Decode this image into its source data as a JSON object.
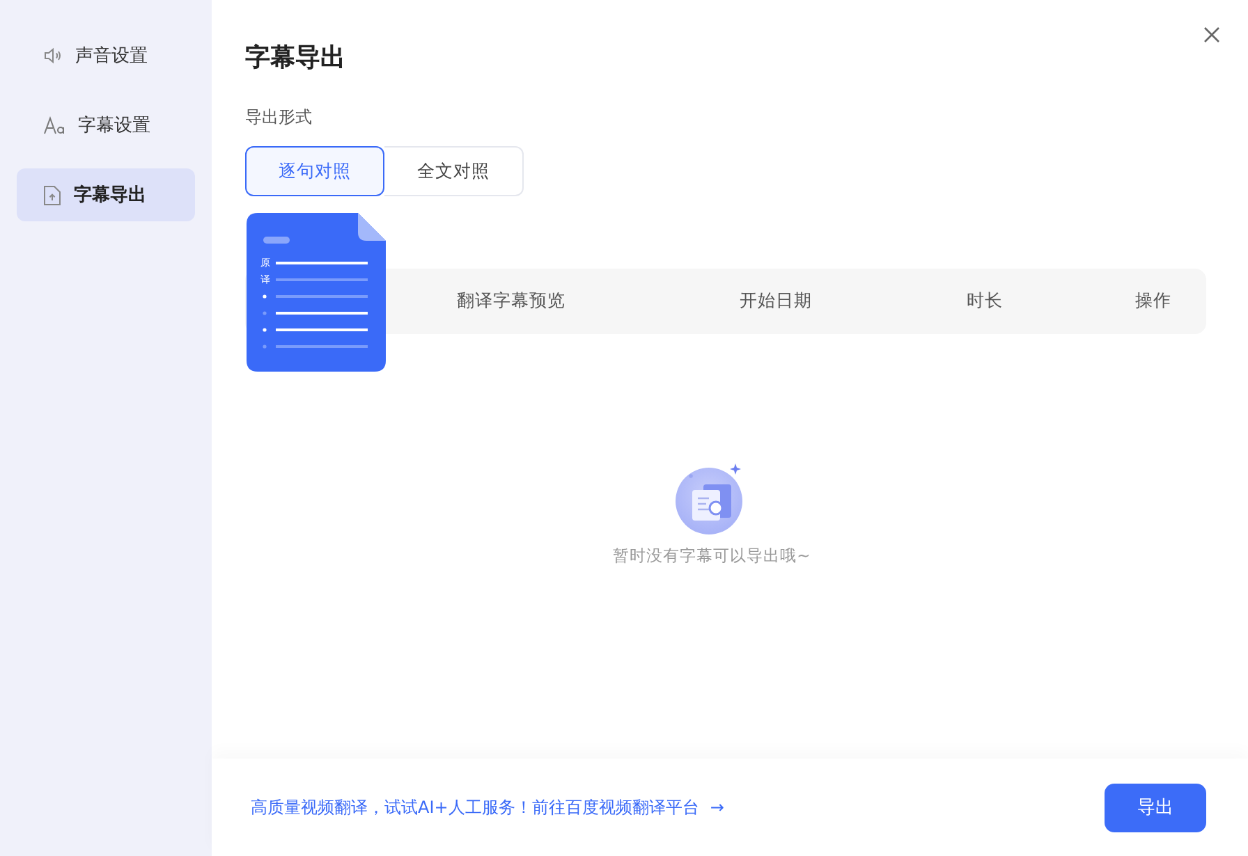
{
  "sidebar": {
    "items": [
      {
        "label": "声音设置",
        "kind": "speaker",
        "selected": false
      },
      {
        "label": "字幕设置",
        "kind": "font",
        "selected": false
      },
      {
        "label": "字幕导出",
        "kind": "export",
        "selected": true
      }
    ]
  },
  "title": "字幕导出",
  "export_format": {
    "label": "导出形式",
    "options": [
      {
        "label": "逐句对照",
        "selected": true
      },
      {
        "label": "全文对照",
        "selected": false
      }
    ]
  },
  "preview_popup": {
    "labels": [
      "原",
      "译"
    ]
  },
  "table": {
    "columns": [
      "翻译字幕预览",
      "开始日期",
      "时长",
      "操作"
    ]
  },
  "empty_state": {
    "text": "暂时没有字幕可以导出哦~"
  },
  "footer": {
    "link": "高质量视频翻译，试试AI+人工服务！前往百度视频翻译平台",
    "link_arrow": "→",
    "button": "导出"
  }
}
